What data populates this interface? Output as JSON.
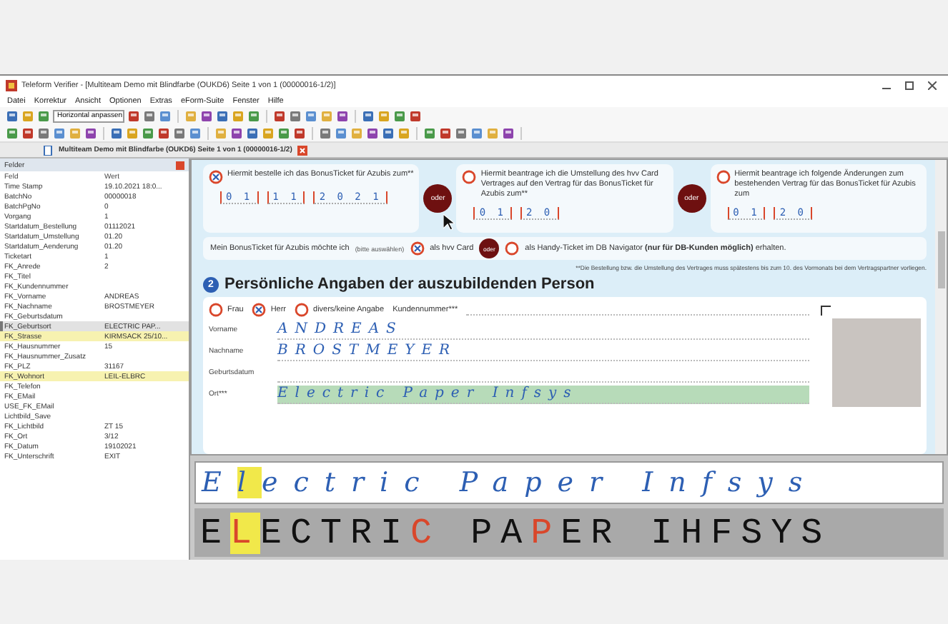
{
  "window": {
    "title": "Teleform Verifier - [Multiteam Demo mit Blindfarbe (OUKD6) Seite 1 von 1 (00000016-1/2)]"
  },
  "menu": [
    "Datei",
    "Korrektur",
    "Ansicht",
    "Optionen",
    "Extras",
    "eForm-Suite",
    "Fenster",
    "Hilfe"
  ],
  "toolbar": {
    "zoom_select": "Horizontal anpassen"
  },
  "document_tab": {
    "label": "Multiteam Demo mit Blindfarbe (OUKD6) Seite 1 von 1 (00000016-1/2)"
  },
  "fields_panel": {
    "title": "Felder",
    "columns": [
      "Feld",
      "Wert"
    ],
    "rows": [
      {
        "field": "Time Stamp",
        "value": "19.10.2021 18:0...",
        "selected": false,
        "flagged": false
      },
      {
        "field": "BatchNo",
        "value": "00000018",
        "selected": false,
        "flagged": false
      },
      {
        "field": "BatchPgNo",
        "value": "0",
        "selected": false,
        "flagged": false
      },
      {
        "field": "Vorgang",
        "value": "1",
        "selected": false,
        "flagged": false
      },
      {
        "field": "Startdatum_Bestellung",
        "value": "01112021",
        "selected": false,
        "flagged": false
      },
      {
        "field": "Startdatum_Umstellung",
        "value": "01.20",
        "selected": false,
        "flagged": false
      },
      {
        "field": "Startdatum_Aenderung",
        "value": "01.20",
        "selected": false,
        "flagged": false
      },
      {
        "field": "Ticketart",
        "value": "1",
        "selected": false,
        "flagged": false
      },
      {
        "field": "FK_Anrede",
        "value": "2",
        "selected": false,
        "flagged": false
      },
      {
        "field": "FK_Titel",
        "selected": false,
        "flagged": false
      },
      {
        "field": "FK_Kundennummer",
        "selected": false,
        "flagged": false
      },
      {
        "field": "FK_Vorname",
        "value": "ANDREAS",
        "selected": false,
        "flagged": false
      },
      {
        "field": "FK_Nachname",
        "value": "BROSTMEYER",
        "selected": false,
        "flagged": false
      },
      {
        "field": "FK_Geburtsdatum",
        "selected": false,
        "flagged": false
      },
      {
        "field": "FK_Geburtsort",
        "value": "ELECTRIC PAP...",
        "selected": true,
        "flagged": false
      },
      {
        "field": "FK_Strasse",
        "value": "KIRMSACK 25/10...",
        "selected": false,
        "flagged": true
      },
      {
        "field": "FK_Hausnummer",
        "value": "15",
        "selected": false,
        "flagged": false
      },
      {
        "field": "FK_Hausnummer_Zusatz",
        "selected": false,
        "flagged": false
      },
      {
        "field": "FK_PLZ",
        "value": "31167",
        "selected": false,
        "flagged": false
      },
      {
        "field": "FK_Wohnort",
        "value": "LEIL-ELBRC",
        "selected": false,
        "flagged": true
      },
      {
        "field": "FK_Telefon",
        "selected": false,
        "flagged": false
      },
      {
        "field": "FK_EMail",
        "selected": false,
        "flagged": false
      },
      {
        "field": "USE_FK_EMail",
        "selected": false,
        "flagged": false
      },
      {
        "field": "Lichtbild_Save",
        "selected": false,
        "flagged": false
      },
      {
        "field": "FK_Lichtbild",
        "value": "ZT 15",
        "selected": false,
        "flagged": false
      },
      {
        "field": "FK_Ort",
        "value": "3/12",
        "selected": false,
        "flagged": false
      },
      {
        "field": "FK_Datum",
        "value": "19102021",
        "selected": false,
        "flagged": false
      },
      {
        "field": "FK_Unterschrift",
        "value": "EXIT",
        "selected": false,
        "flagged": false
      }
    ]
  },
  "form": {
    "order_options": [
      {
        "text": "Hiermit bestelle ich das BonusTicket für Azubis zum**",
        "checked": true,
        "date_parts": [
          "0 1",
          "1 1",
          "2 0 2 1"
        ]
      },
      {
        "text": "Hiermit beantrage ich die Umstellung des hvv Card Vertrages auf den Vertrag für das BonusTicket für Azubis zum**",
        "checked": false,
        "date_parts": [
          "0 1",
          "2 0"
        ]
      },
      {
        "text": "Hiermit beantrage ich folgende Änderungen zum bestehenden Vertrag für das BonusTicket für Azubis zum",
        "checked": false,
        "date_parts": [
          "0 1",
          "2 0"
        ]
      }
    ],
    "separators": [
      "oder",
      "oder"
    ],
    "delivery": {
      "label": "Mein BonusTicket für Azubis möchte ich",
      "hint": "(bitte auswählen)",
      "separator": "oder",
      "options": [
        {
          "text": "als hvv Card",
          "checked": true
        },
        {
          "text": "als Handy-Ticket im DB Navigator **(nur für DB-Kunden möglich)** erhalten.",
          "checked": false
        }
      ]
    },
    "footnote": "**Die Bestellung bzw. die Umstellung des Vertrages muss spätestens bis zum 10. des Vormonats bei dem Vertragspartner vorliegen.",
    "section": {
      "number": "2",
      "title": "Persönliche Angaben der auszubildenden Person"
    },
    "gender_options": [
      {
        "text": "Frau",
        "checked": false
      },
      {
        "text": "Herr",
        "checked": true
      },
      {
        "text": "divers/keine Angabe",
        "checked": false
      }
    ],
    "customer_number_label": "Kundennummer***",
    "inputs": [
      {
        "label": "Vorname",
        "value": "ANDREAS",
        "highlighted": false
      },
      {
        "label": "Nachname",
        "value": "BROSTMEYER",
        "highlighted": false
      },
      {
        "label": "Geburtsdatum",
        "highlighted": false
      },
      {
        "label": "Ort***",
        "value": "Electric Paper Infsys",
        "highlighted": true
      }
    ]
  },
  "verification": {
    "handwriting": [
      {
        "text": "E",
        "selected": false
      },
      {
        "text": "l",
        "selected": true
      },
      {
        "text": "ectric Paper Infsys",
        "selected": false
      }
    ],
    "recognized": [
      {
        "text": "E",
        "selected": false,
        "uncertain": false
      },
      {
        "text": "L",
        "selected": true,
        "uncertain": true
      },
      {
        "text": "ECTRI",
        "selected": false,
        "uncertain": false
      },
      {
        "text": "C",
        "selected": false,
        "uncertain": true
      },
      {
        "text": " PA",
        "selected": false,
        "uncertain": false
      },
      {
        "text": "P",
        "selected": false,
        "uncertain": true
      },
      {
        "text": "ER IHFSYS",
        "selected": false,
        "uncertain": false
      }
    ]
  }
}
